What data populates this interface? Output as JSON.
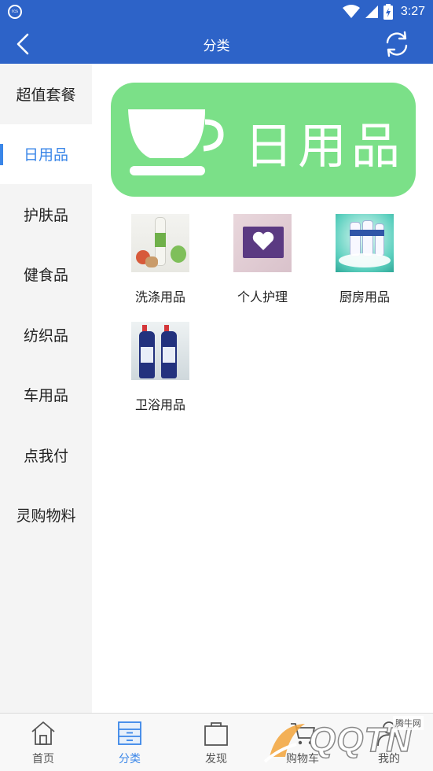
{
  "status_bar": {
    "left_icon_text": "rcs",
    "time": "3:27",
    "icons": [
      "wifi-icon",
      "signal-icon",
      "battery-icon"
    ]
  },
  "nav": {
    "title": "分类",
    "back_icon": "chevron-left-icon",
    "refresh_icon": "refresh-icon"
  },
  "sidebar": {
    "items": [
      {
        "label": "超值套餐",
        "active": false
      },
      {
        "label": "日用品",
        "active": true
      },
      {
        "label": "护肤品",
        "active": false
      },
      {
        "label": "健食品",
        "active": false
      },
      {
        "label": "纺织品",
        "active": false
      },
      {
        "label": "车用品",
        "active": false
      },
      {
        "label": "点我付",
        "active": false
      },
      {
        "label": "灵购物料",
        "active": false
      }
    ]
  },
  "banner": {
    "text": "日用品",
    "icon": "teacup-icon",
    "color": "#7be088"
  },
  "categories": [
    {
      "label": "洗涤用品",
      "image": "detergent-products-image"
    },
    {
      "label": "个人护理",
      "image": "personal-care-image"
    },
    {
      "label": "厨房用品",
      "image": "kitchen-products-image"
    },
    {
      "label": "卫浴用品",
      "image": "bathroom-cleaner-image"
    }
  ],
  "tab_bar": {
    "tabs": [
      {
        "label": "首页",
        "icon": "home-icon",
        "active": false
      },
      {
        "label": "分类",
        "icon": "category-icon",
        "active": true
      },
      {
        "label": "发现",
        "icon": "bag-icon",
        "active": false
      },
      {
        "label": "购物车",
        "icon": "cart-icon",
        "active": false
      },
      {
        "label": "我的",
        "icon": "person-icon",
        "active": false
      }
    ]
  },
  "watermark": {
    "text": "QQTN",
    "small_text": "腾牛网"
  },
  "colors": {
    "primary": "#2d63c8",
    "accent": "#3a86e8",
    "banner": "#7be088"
  }
}
